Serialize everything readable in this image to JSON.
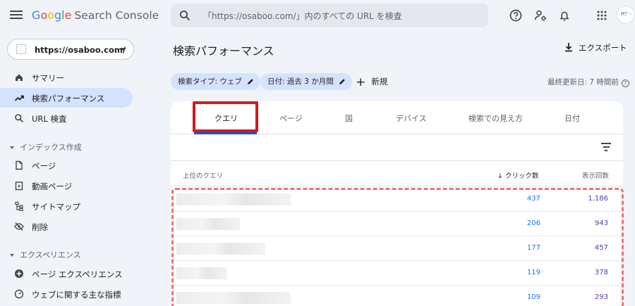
{
  "topbar": {
    "logo_letters": [
      {
        "ch": "G",
        "color": "#4285f4"
      },
      {
        "ch": "o",
        "color": "#ea4335"
      },
      {
        "ch": "o",
        "color": "#fbbc05"
      },
      {
        "ch": "g",
        "color": "#4285f4"
      },
      {
        "ch": "l",
        "color": "#34a853"
      },
      {
        "ch": "e",
        "color": "#ea4335"
      }
    ],
    "product": "Search Console",
    "search_placeholder": "「https://osaboo.com/」内のすべての URL を検査",
    "avatar_text": "ｵｻﾌﾞｰ"
  },
  "sidebar": {
    "property": "https://osaboo.com/",
    "items": [
      {
        "label": "サマリー",
        "icon": "home-icon"
      },
      {
        "label": "検索パフォーマンス",
        "icon": "trending-up-icon"
      },
      {
        "label": "URL 検査",
        "icon": "search-icon"
      }
    ],
    "section_index": "インデックス作成",
    "index_items": [
      {
        "label": "ページ",
        "icon": "pages-icon"
      },
      {
        "label": "動画ページ",
        "icon": "video-page-icon"
      },
      {
        "label": "サイトマップ",
        "icon": "sitemap-icon"
      },
      {
        "label": "削除",
        "icon": "removal-icon"
      }
    ],
    "section_experience": "エクスペリエンス",
    "experience_items": [
      {
        "label": "ページ エクスペリエンス",
        "icon": "page-experience-icon"
      },
      {
        "label": "ウェブに関する主な指標",
        "icon": "web-vitals-icon"
      }
    ]
  },
  "main": {
    "title": "検索パフォーマンス",
    "export_label": "エクスポート",
    "chips": [
      "検索タイプ: ウェブ",
      "日付: 過去 3 か月間"
    ],
    "new_label": "新規",
    "updated": "最終更新日: 7 時間前"
  },
  "report": {
    "tabs": [
      "クエリ",
      "ページ",
      "国",
      "デバイス",
      "検索での見え方",
      "日付"
    ],
    "active_tab": "クエリ",
    "columns": {
      "query": "上位のクエリ",
      "clicks": "クリック数",
      "impressions": "表示回数"
    },
    "rows": [
      {
        "clicks": "437",
        "impressions": "1,186"
      },
      {
        "clicks": "206",
        "impressions": "943"
      },
      {
        "clicks": "177",
        "impressions": "457"
      },
      {
        "clicks": "119",
        "impressions": "378"
      },
      {
        "clicks": "109",
        "impressions": "293"
      }
    ],
    "clicks_color": "#1a73e8",
    "impressions_color": "#5e35b1",
    "highlight_color": "#d21b1b",
    "dash_color": "#ef7474"
  }
}
